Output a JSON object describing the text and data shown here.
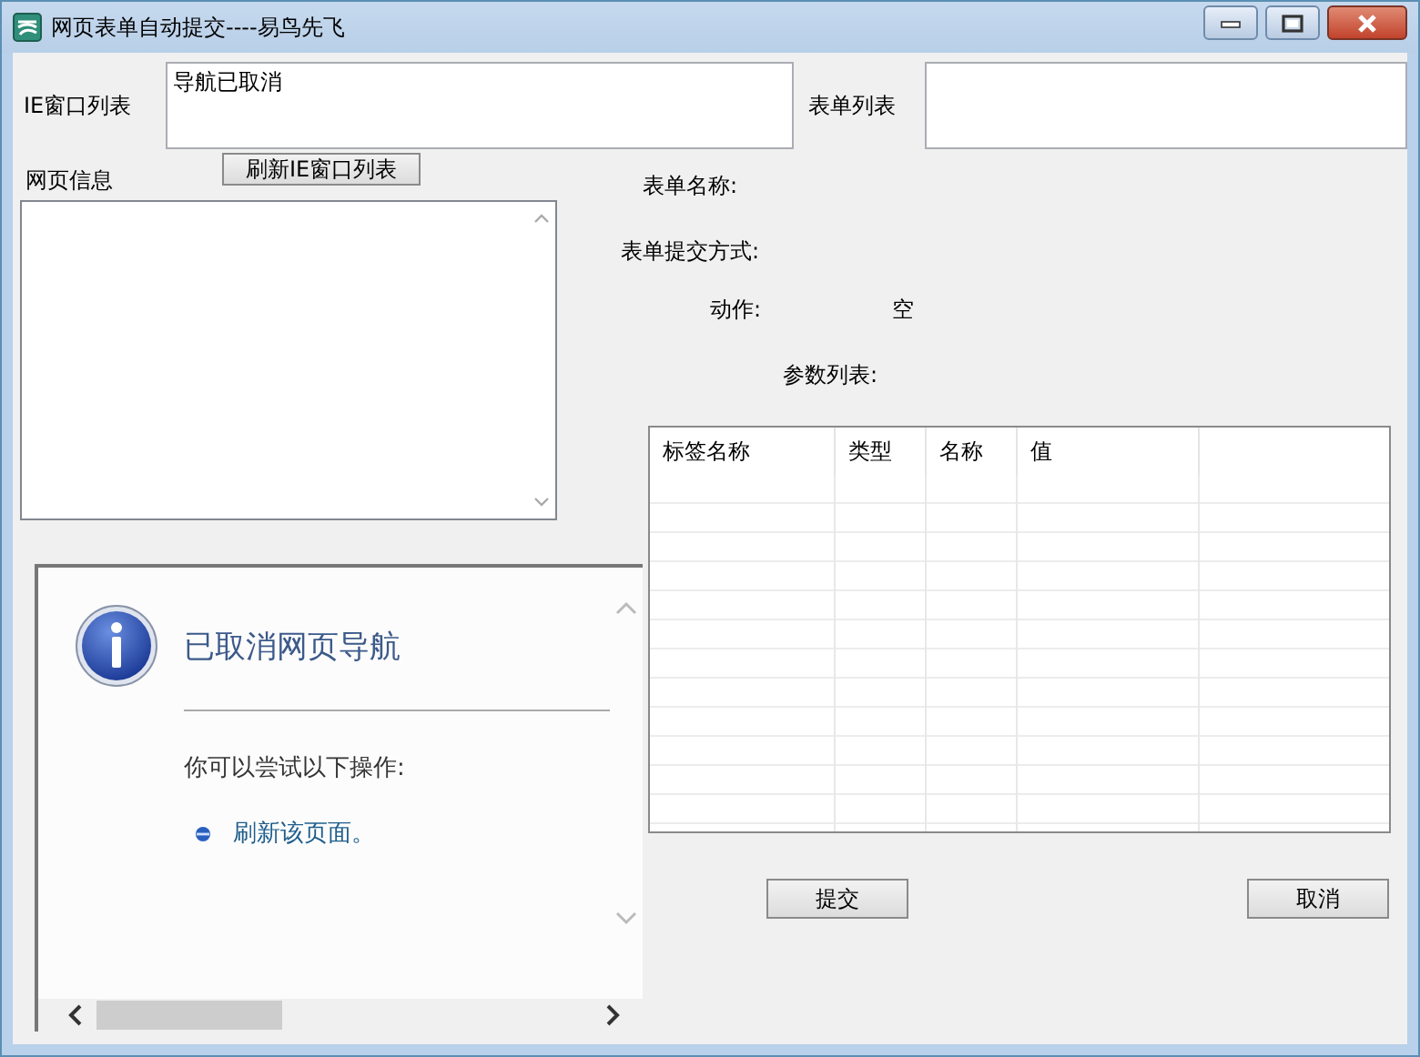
{
  "window": {
    "title": "网页表单自动提交----易鸟先飞"
  },
  "ie_window_list": {
    "label": "IE窗口列表",
    "items": [
      "导航已取消"
    ]
  },
  "form_list": {
    "label": "表单列表"
  },
  "page_info": {
    "label": "网页信息"
  },
  "refresh_button": "刷新IE窗口列表",
  "form_details": [
    {
      "label": "表单名称:"
    },
    {
      "label": "表单提交方式:"
    },
    {
      "label": "动作:",
      "value": "空"
    },
    {
      "label": "参数列表:"
    }
  ],
  "params_table": {
    "columns": [
      "标签名称",
      "类型",
      "名称",
      "值"
    ]
  },
  "browser": {
    "heading": "已取消网页导航",
    "prompt": "你可以尝试以下操作:",
    "actions": [
      "刷新该页面。"
    ]
  },
  "buttons": [
    "提交",
    "取消"
  ]
}
